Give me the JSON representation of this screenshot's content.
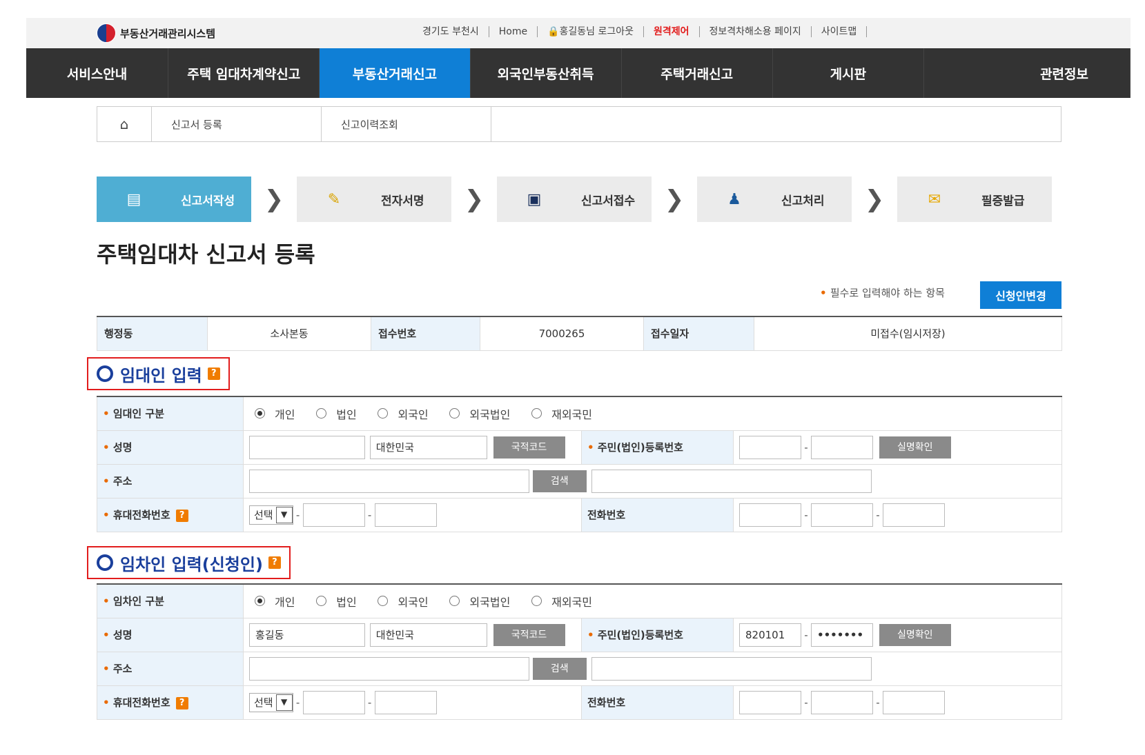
{
  "header": {
    "logo_text": "부동산거래관리시스템",
    "util_links": [
      {
        "label": "경기도 부천시"
      },
      {
        "label": "Home"
      },
      {
        "label": "🔒홍길동님 로그아웃"
      },
      {
        "label": "원격제어",
        "highlight": true
      },
      {
        "label": "정보격차해소용 페이지"
      },
      {
        "label": "사이트맵"
      }
    ]
  },
  "nav": {
    "items": [
      {
        "label": "서비스안내"
      },
      {
        "label": "주택 임대차계약신고"
      },
      {
        "label": "부동산거래신고",
        "active": true
      },
      {
        "label": "외국인부동산취득"
      },
      {
        "label": "주택거래신고"
      },
      {
        "label": "게시판"
      },
      {
        "label": "관련정보"
      }
    ],
    "active_color": "#0f7fd6"
  },
  "breadcrumb": {
    "items": [
      "신고서 등록",
      "신고이력조회"
    ]
  },
  "steps": [
    {
      "label": "신고서작성",
      "icon": "document-icon",
      "active": true
    },
    {
      "label": "전자서명",
      "icon": "pen-icon"
    },
    {
      "label": "신고서접수",
      "icon": "file-icon"
    },
    {
      "label": "신고처리",
      "icon": "person-icon"
    },
    {
      "label": "필증발급",
      "icon": "certificate-icon"
    }
  ],
  "page_title": "주택임대차 신고서 등록",
  "required_note": "필수로 입력해야 하는 항목",
  "change_button": "신청인변경",
  "info": {
    "labels": [
      "행정동",
      "접수번호",
      "접수일자"
    ],
    "values": [
      "소사본동",
      "7000265",
      "미접수(임시저장)"
    ]
  },
  "lessor": {
    "section_title": "임대인 입력",
    "type_label": "임대인 구분",
    "types": [
      "개인",
      "법인",
      "외국인",
      "외국법인",
      "재외국민"
    ],
    "selected_type": 0,
    "name_label": "성명",
    "name_value": "",
    "nation_value": "대한민국",
    "nation_button": "국적코드",
    "id_label": "주민(법인)등록번호",
    "id_front": "",
    "id_back": "",
    "verify_button": "실명확인",
    "address_label": "주소",
    "search_button": "검색",
    "mobile_label": "휴대전화번호",
    "mobile_select": "선택",
    "phone_label": "전화번호"
  },
  "lessee": {
    "section_title": "임차인 입력(신청인)",
    "type_label": "임차인 구분",
    "types": [
      "개인",
      "법인",
      "외국인",
      "외국법인",
      "재외국민"
    ],
    "selected_type": 0,
    "name_label": "성명",
    "name_value": "홍길동",
    "nation_value": "대한민국",
    "nation_button": "국적코드",
    "id_label": "주민(법인)등록번호",
    "id_front": "820101",
    "id_back": "•••••••",
    "verify_button": "실명확인",
    "address_label": "주소",
    "search_button": "검색",
    "mobile_label": "휴대전화번호",
    "mobile_select": "선택",
    "phone_label": "전화번호"
  }
}
